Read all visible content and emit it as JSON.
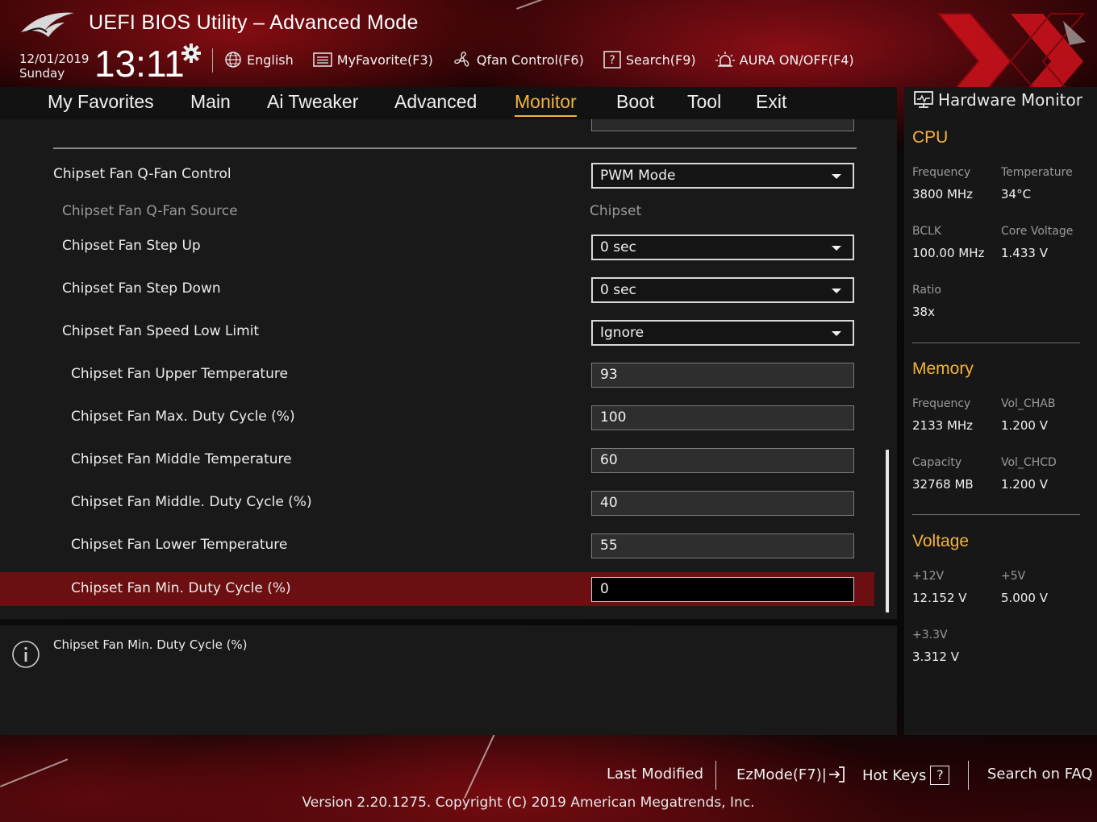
{
  "header": {
    "title": "UEFI BIOS Utility – Advanced Mode",
    "date": "12/01/2019",
    "day": "Sunday",
    "time": "13:11",
    "toolbar": {
      "language": "English",
      "myfavorite": "MyFavorite(F3)",
      "qfan": "Qfan Control(F6)",
      "search": "Search(F9)",
      "aura": "AURA ON/OFF(F4)"
    }
  },
  "nav": {
    "tabs": [
      "My Favorites",
      "Main",
      "Ai Tweaker",
      "Advanced",
      "Monitor",
      "Boot",
      "Tool",
      "Exit"
    ],
    "active": "Monitor"
  },
  "settings": {
    "rows": [
      {
        "label": "Chipset Fan Q-Fan Control",
        "value": "PWM Mode"
      },
      {
        "label": "Chipset Fan Q-Fan Source",
        "value": "Chipset"
      },
      {
        "label": "Chipset Fan Step Up",
        "value": "0 sec"
      },
      {
        "label": "Chipset Fan Step Down",
        "value": "0 sec"
      },
      {
        "label": "Chipset Fan Speed Low Limit",
        "value": "Ignore"
      },
      {
        "label": "Chipset Fan Upper Temperature",
        "value": "93"
      },
      {
        "label": "Chipset Fan Max. Duty Cycle (%)",
        "value": "100"
      },
      {
        "label": "Chipset Fan Middle Temperature",
        "value": "60"
      },
      {
        "label": "Chipset Fan Middle. Duty Cycle (%)",
        "value": "40"
      },
      {
        "label": "Chipset Fan Lower Temperature",
        "value": "55"
      },
      {
        "label": "Chipset Fan Min. Duty Cycle (%)",
        "value": "0"
      }
    ]
  },
  "info": {
    "text": "Chipset Fan Min. Duty Cycle (%)"
  },
  "hw": {
    "title": "Hardware Monitor",
    "cpu": {
      "heading": "CPU",
      "frequency_label": "Frequency",
      "frequency": "3800 MHz",
      "temperature_label": "Temperature",
      "temperature": "34°C",
      "bclk_label": "BCLK",
      "bclk": "100.00 MHz",
      "core_voltage_label": "Core Voltage",
      "core_voltage": "1.433 V",
      "ratio_label": "Ratio",
      "ratio": "38x"
    },
    "memory": {
      "heading": "Memory",
      "frequency_label": "Frequency",
      "frequency": "2133 MHz",
      "vol_chab_label": "Vol_CHAB",
      "vol_chab": "1.200 V",
      "capacity_label": "Capacity",
      "capacity": "32768 MB",
      "vol_chcd_label": "Vol_CHCD",
      "vol_chcd": "1.200 V"
    },
    "voltage": {
      "heading": "Voltage",
      "v12_label": "+12V",
      "v12": "12.152 V",
      "v5_label": "+5V",
      "v5": "5.000 V",
      "v33_label": "+3.3V",
      "v33": "3.312 V"
    }
  },
  "footer": {
    "last_modified": "Last Modified",
    "ezmode": "EzMode(F7)|",
    "hotkeys": "Hot Keys",
    "hotkeys_key": "?",
    "faq": "Search on FAQ",
    "version": "Version 2.20.1275. Copyright (C) 2019 American Megatrends, Inc."
  },
  "colors": {
    "accent": "#f3b33d",
    "selected_row": "#6b0f12",
    "panel": "#191919"
  }
}
